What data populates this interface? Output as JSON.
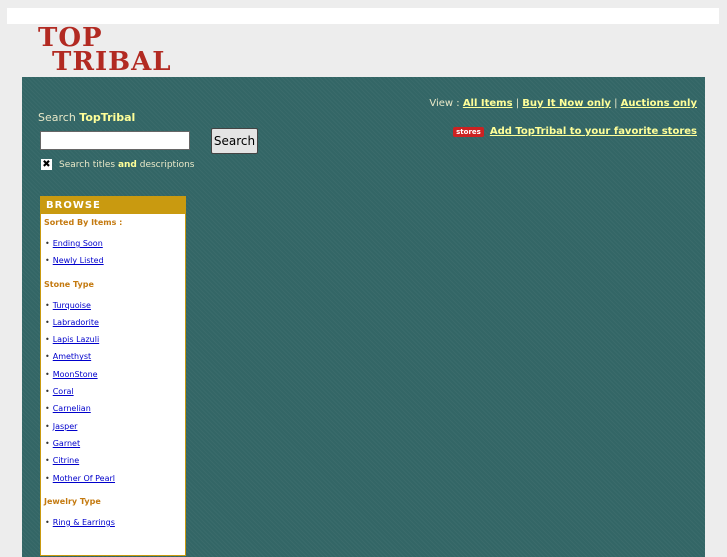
{
  "logo": {
    "line1": "TOP",
    "line2": "TRIBAL"
  },
  "search": {
    "label_prefix": "Search ",
    "label_brand": "TopTribal",
    "input_value": "",
    "button_label": "Search",
    "checkbox_mark": "✖",
    "checkbox_text_1": "Search titles ",
    "checkbox_text_and": "and",
    "checkbox_text_2": " descriptions"
  },
  "view": {
    "prefix": "View : ",
    "all_items": "All Items",
    "sep1": " | ",
    "buy_it_now": "Buy It Now only",
    "sep2": " | ",
    "auctions": "Auctions only"
  },
  "favorites": {
    "badge": "stores",
    "link": "Add TopTribal to your favorite stores"
  },
  "browse": {
    "header": "BROWSE",
    "sorted_title": "Sorted By Items :",
    "sorted_items": [
      "Ending Soon",
      "Newly Listed"
    ],
    "stone_title": "Stone Type",
    "stone_items": [
      "Turquoise",
      "Labradorite",
      "Lapis Lazuli",
      "Amethyst",
      "MoonStone",
      "Coral",
      "Carnelian",
      "Jasper",
      "Garnet",
      "Citrine",
      "Mother Of Pearl"
    ],
    "jewelry_title": "Jewelry Type",
    "jewelry_items": [
      "Ring & Earrings"
    ]
  },
  "colors": {
    "panel": "#336666",
    "accent": "#c99a10",
    "logo": "#b22a22",
    "link_yellow": "#ffff99"
  }
}
